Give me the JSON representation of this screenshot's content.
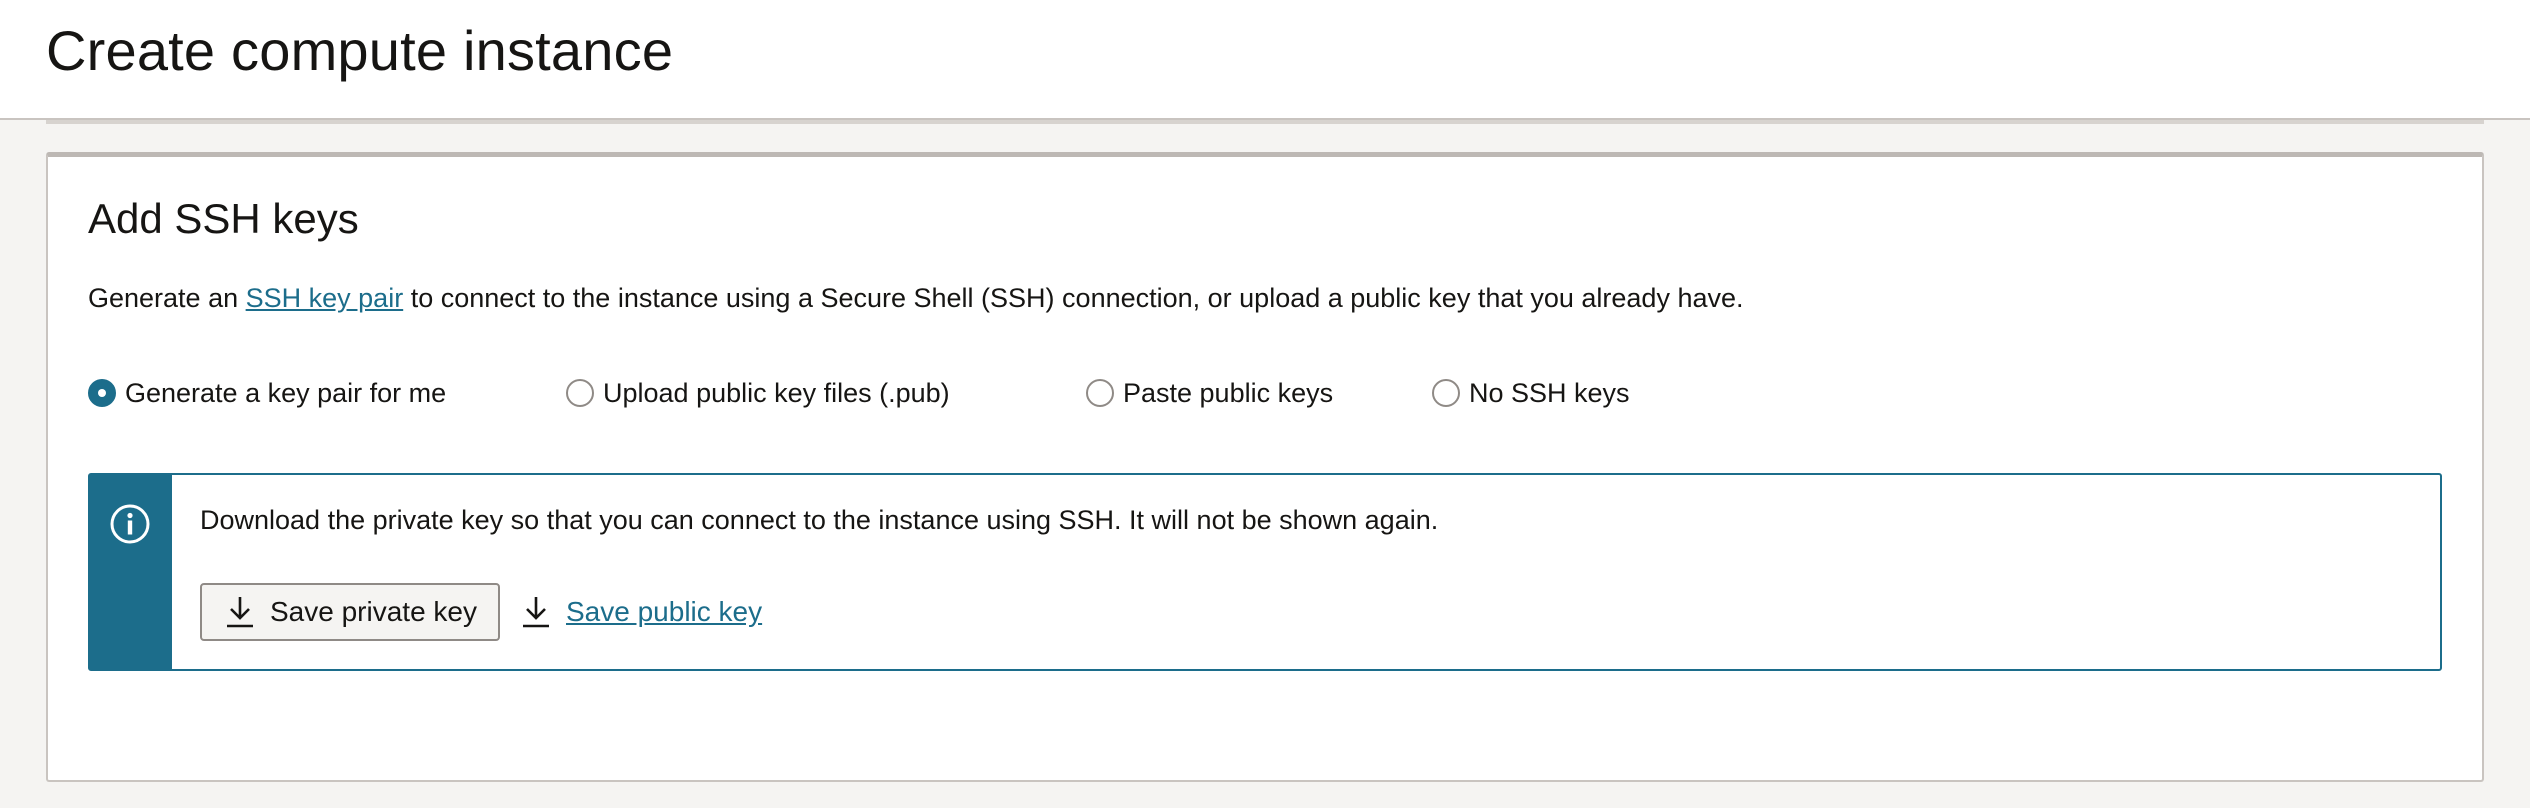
{
  "header": {
    "title": "Create compute instance"
  },
  "ssh_section": {
    "title": "Add SSH keys",
    "description_before": "Generate an ",
    "description_link": "SSH key pair",
    "description_after": " to connect to the instance using a Secure Shell (SSH) connection, or upload a public key that you already have.",
    "options": [
      {
        "label": "Generate a key pair for me",
        "selected": true
      },
      {
        "label": "Upload public key files (.pub)",
        "selected": false
      },
      {
        "label": "Paste public keys",
        "selected": false
      },
      {
        "label": "No SSH keys",
        "selected": false
      }
    ],
    "info": {
      "message": "Download the private key so that you can connect to the instance using SSH. It will not be shown again.",
      "save_private_label": "Save private key",
      "save_public_label": "Save public key"
    }
  },
  "icons": {
    "info": "info-circle-icon",
    "download": "download-icon"
  },
  "colors": {
    "accent": "#1c6d8b",
    "text": "#161513",
    "background": "#f5f4f2",
    "border": "#c9c4c0"
  }
}
